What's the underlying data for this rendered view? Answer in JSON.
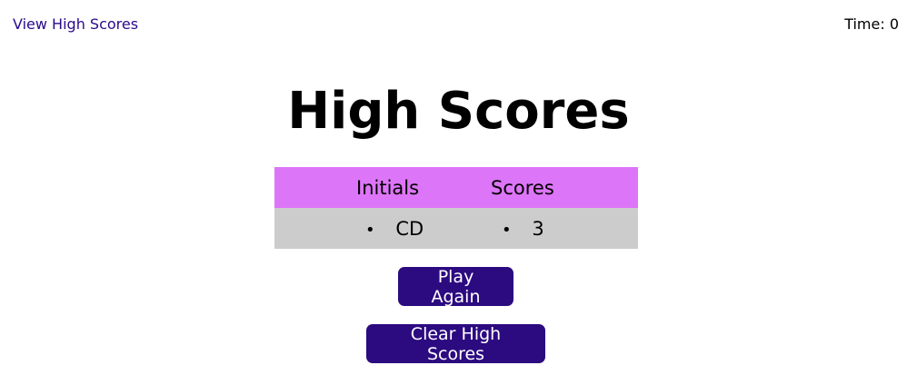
{
  "header": {
    "view_high_scores": "View High Scores",
    "time_label": "Time: 0"
  },
  "main": {
    "title": "High Scores",
    "table": {
      "headers": [
        "Initials",
        "Scores"
      ],
      "rows": [
        {
          "initials": "CD",
          "score": "3"
        }
      ]
    },
    "buttons": {
      "play_again": "Play Again",
      "clear_high_scores": "Clear High Scores"
    }
  },
  "colors": {
    "link": "#2b0a8c",
    "header_row": "#dd75f8",
    "body_row": "#cccccc",
    "button_bg": "#2c0a80",
    "button_text": "#ffffff"
  }
}
